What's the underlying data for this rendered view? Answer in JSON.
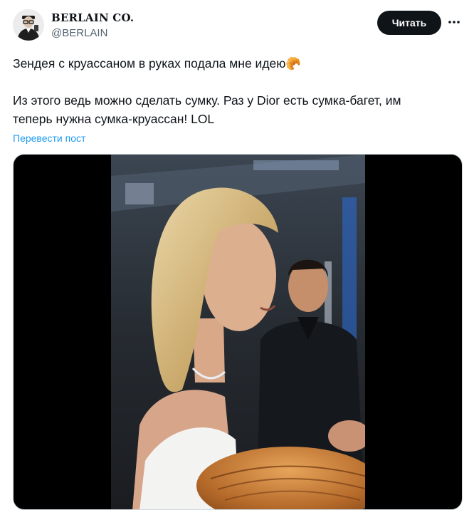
{
  "author": {
    "name": "BERLAIN CO.",
    "handle": "@BERLAIN",
    "avatar_icon": "avatar-portrait-icon"
  },
  "actions": {
    "follow_label": "Читать",
    "more_icon": "more-horizontal-icon"
  },
  "tweet": {
    "line1": "Зендея с круассаном в руках подала мне идею",
    "emoji": "🥐",
    "line2": "Из этого ведь можно сделать сумку. Раз у Dior есть сумка-багет, им",
    "line3": "теперь нужна сумка-круассан! LOL",
    "translate_label": "Перевести пост"
  },
  "colors": {
    "text": "#0f1419",
    "secondary": "#536471",
    "link": "#1d9bf0",
    "button_bg": "#0f1419"
  }
}
